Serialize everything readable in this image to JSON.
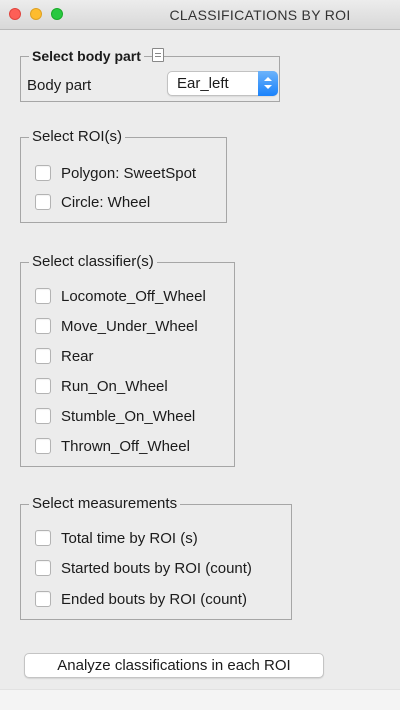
{
  "window": {
    "title": "CLASSIFICATIONS BY ROI"
  },
  "body_part": {
    "legend": "Select body part",
    "label": "Body part",
    "selected": "Ear_left"
  },
  "roi": {
    "legend": "Select ROI(s)",
    "items": [
      {
        "label": "Polygon: SweetSpot",
        "checked": false
      },
      {
        "label": "Circle: Wheel",
        "checked": false
      }
    ]
  },
  "classifiers": {
    "legend": "Select classifier(s)",
    "items": [
      {
        "label": "Locomote_Off_Wheel",
        "checked": false
      },
      {
        "label": "Move_Under_Wheel",
        "checked": false
      },
      {
        "label": "Rear",
        "checked": false
      },
      {
        "label": "Run_On_Wheel",
        "checked": false
      },
      {
        "label": "Stumble_On_Wheel",
        "checked": false
      },
      {
        "label": "Thrown_Off_Wheel",
        "checked": false
      }
    ]
  },
  "measurements": {
    "legend": "Select measurements",
    "items": [
      {
        "label": "Total time by ROI (s)",
        "checked": false
      },
      {
        "label": "Started bouts by ROI (count)",
        "checked": false
      },
      {
        "label": "Ended bouts by ROI (count)",
        "checked": false
      }
    ]
  },
  "actions": {
    "analyze_label": "Analyze classifications in each ROI"
  }
}
